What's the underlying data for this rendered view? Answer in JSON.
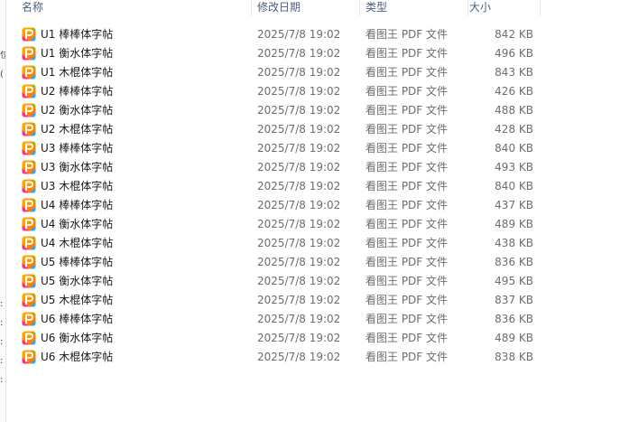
{
  "columns": {
    "name": "名称",
    "modified": "修改日期",
    "type": "类型",
    "size": "大小"
  },
  "left_fragments": [
    "位",
    "(",
    ":",
    ":",
    ":",
    ":",
    ":"
  ],
  "files": [
    {
      "name": "U1 棒棒体字帖",
      "modified": "2025/7/8 19:02",
      "type": "看图王 PDF 文件",
      "size": "842 KB",
      "icon": "pdf-viewer-icon"
    },
    {
      "name": "U1 衡水体字帖",
      "modified": "2025/7/8 19:02",
      "type": "看图王 PDF 文件",
      "size": "496 KB",
      "icon": "pdf-viewer-icon"
    },
    {
      "name": "U1 木棍体字帖",
      "modified": "2025/7/8 19:02",
      "type": "看图王 PDF 文件",
      "size": "843 KB",
      "icon": "pdf-viewer-icon"
    },
    {
      "name": "U2 棒棒体字帖",
      "modified": "2025/7/8 19:02",
      "type": "看图王 PDF 文件",
      "size": "426 KB",
      "icon": "pdf-viewer-icon"
    },
    {
      "name": "U2 衡水体字帖",
      "modified": "2025/7/8 19:02",
      "type": "看图王 PDF 文件",
      "size": "488 KB",
      "icon": "pdf-viewer-icon"
    },
    {
      "name": "U2 木棍体字帖",
      "modified": "2025/7/8 19:02",
      "type": "看图王 PDF 文件",
      "size": "428 KB",
      "icon": "pdf-viewer-icon"
    },
    {
      "name": "U3 棒棒体字帖",
      "modified": "2025/7/8 19:02",
      "type": "看图王 PDF 文件",
      "size": "840 KB",
      "icon": "pdf-viewer-icon"
    },
    {
      "name": "U3 衡水体字帖",
      "modified": "2025/7/8 19:02",
      "type": "看图王 PDF 文件",
      "size": "493 KB",
      "icon": "pdf-viewer-icon"
    },
    {
      "name": "U3 木棍体字帖",
      "modified": "2025/7/8 19:02",
      "type": "看图王 PDF 文件",
      "size": "840 KB",
      "icon": "pdf-viewer-icon"
    },
    {
      "name": "U4 棒棒体字帖",
      "modified": "2025/7/8 19:02",
      "type": "看图王 PDF 文件",
      "size": "437 KB",
      "icon": "pdf-viewer-icon"
    },
    {
      "name": "U4 衡水体字帖",
      "modified": "2025/7/8 19:02",
      "type": "看图王 PDF 文件",
      "size": "489 KB",
      "icon": "pdf-viewer-icon"
    },
    {
      "name": "U4 木棍体字帖",
      "modified": "2025/7/8 19:02",
      "type": "看图王 PDF 文件",
      "size": "438 KB",
      "icon": "pdf-viewer-icon"
    },
    {
      "name": "U5 棒棒体字帖",
      "modified": "2025/7/8 19:02",
      "type": "看图王 PDF 文件",
      "size": "836 KB",
      "icon": "pdf-viewer-icon"
    },
    {
      "name": "U5 衡水体字帖",
      "modified": "2025/7/8 19:02",
      "type": "看图王 PDF 文件",
      "size": "495 KB",
      "icon": "pdf-viewer-icon"
    },
    {
      "name": "U5 木棍体字帖",
      "modified": "2025/7/8 19:02",
      "type": "看图王 PDF 文件",
      "size": "837 KB",
      "icon": "pdf-viewer-icon"
    },
    {
      "name": "U6 棒棒体字帖",
      "modified": "2025/7/8 19:02",
      "type": "看图王 PDF 文件",
      "size": "836 KB",
      "icon": "pdf-viewer-icon"
    },
    {
      "name": "U6 衡水体字帖",
      "modified": "2025/7/8 19:02",
      "type": "看图王 PDF 文件",
      "size": "489 KB",
      "icon": "pdf-viewer-icon"
    },
    {
      "name": "U6 木棍体字帖",
      "modified": "2025/7/8 19:02",
      "type": "看图王 PDF 文件",
      "size": "838 KB",
      "icon": "pdf-viewer-icon"
    }
  ],
  "colors": {
    "header_text": "#4c607a",
    "secondary_text": "#6d6d6d",
    "primary_text": "#1a1a1a",
    "icon_orange": "#ff8a00",
    "icon_pink": "#ff2f8a",
    "icon_blue": "#2aa7ff",
    "icon_green": "#5ed42a"
  }
}
